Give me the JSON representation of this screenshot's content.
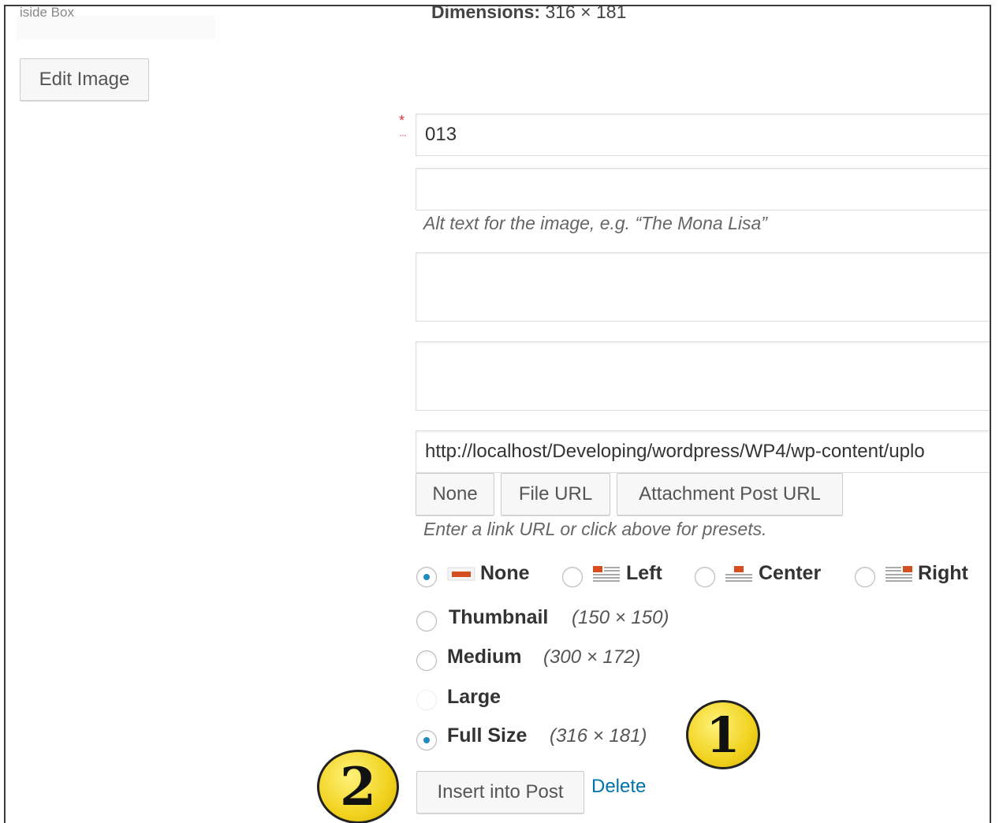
{
  "header": {
    "partial_label": "iside Box",
    "dimensions_label": "Dimensions:",
    "dimensions_value": "316 × 181"
  },
  "edit_button": "Edit Image",
  "required_mark": "*",
  "fields": {
    "title_value": "013",
    "alt_value": "",
    "alt_hint": "Alt text for the image, e.g. “The Mona Lisa”",
    "caption_value": "",
    "description_value": "",
    "link_url_value": "http://localhost/Developing/wordpress/WP4/wp-content/uplo"
  },
  "link_buttons": [
    "None",
    "File URL",
    "Attachment Post URL"
  ],
  "link_hint": "Enter a link URL or click above for presets.",
  "alignment": {
    "selected": "None",
    "options": [
      "None",
      "Left",
      "Center",
      "Right"
    ],
    "icon_color": "#d54e21"
  },
  "sizes": {
    "selected": "Full Size",
    "options": [
      {
        "label": "Thumbnail",
        "dims": "(150 × 150)",
        "enabled": true
      },
      {
        "label": "Medium",
        "dims": "(300 × 172)",
        "enabled": true
      },
      {
        "label": "Large",
        "dims": "",
        "enabled": false
      },
      {
        "label": "Full Size",
        "dims": "(316 × 181)",
        "enabled": true
      }
    ]
  },
  "actions": {
    "insert_label": "Insert into Post",
    "delete_label": "Delete",
    "link_color": "#0073aa"
  },
  "annotations": {
    "badge_1": "1",
    "badge_2": "2",
    "badge_color": "#f1d21e"
  }
}
